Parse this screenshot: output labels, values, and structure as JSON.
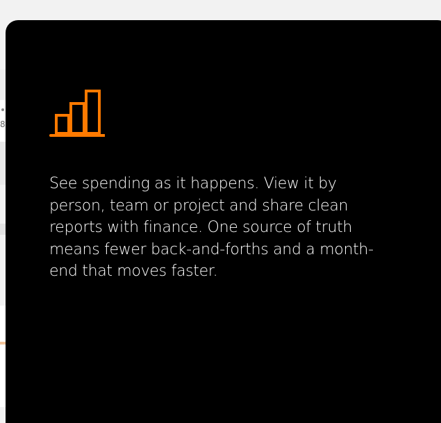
{
  "background_page": {
    "partial_text": "8"
  },
  "card": {
    "icon": "bar-chart-icon",
    "accent_color": "#ff7a00",
    "background_color": "#000000",
    "text_color": "#ffffff",
    "description": "See spending as it happens. View it by person, team or project and share clean reports with finance. One source of truth means fewer back-and-forths and a month-end that moves faster."
  }
}
